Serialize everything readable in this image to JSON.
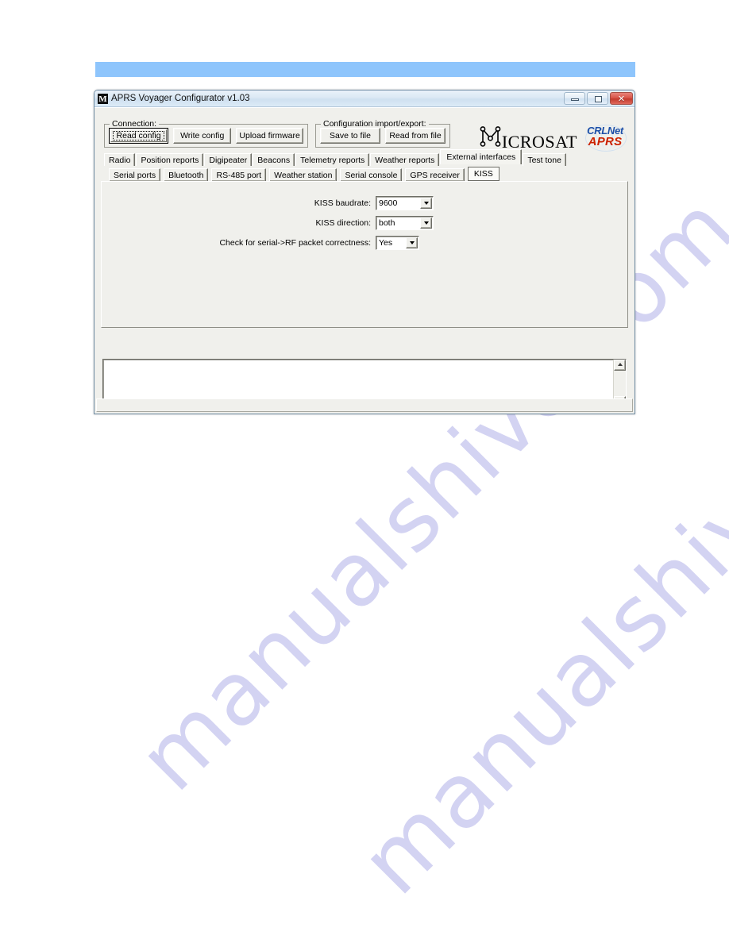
{
  "page": {
    "watermark": "manualshive.com",
    "band_color": "#8ec5fc"
  },
  "window": {
    "title": "APRS Voyager Configurator v1.03",
    "icon": "microsat-m-icon",
    "controls": {
      "minimize": "minimize-icon",
      "maximize": "maximize-icon",
      "close": "✕"
    }
  },
  "toolbar": {
    "connection_group": {
      "title": "Connection:",
      "buttons": [
        {
          "label": "Read config",
          "default": true
        },
        {
          "label": "Write config",
          "default": false
        },
        {
          "label": "Upload firmware",
          "default": false
        }
      ]
    },
    "config_group": {
      "title": "Configuration import/export:",
      "buttons": [
        {
          "label": "Save to file"
        },
        {
          "label": "Read from file"
        }
      ]
    }
  },
  "branding": {
    "microsat": "ICROSAT",
    "microsat_initial": "M",
    "crlnet": "CRLNet",
    "aprs": "APRS",
    "crlnet_color": "#1c4fa8",
    "aprs_color": "#cc2200"
  },
  "tabs": {
    "primary": [
      {
        "label": "Radio",
        "selected": false
      },
      {
        "label": "Position reports",
        "selected": false
      },
      {
        "label": "Digipeater",
        "selected": false
      },
      {
        "label": "Beacons",
        "selected": false
      },
      {
        "label": "Telemetry reports",
        "selected": false
      },
      {
        "label": "Weather reports",
        "selected": false
      },
      {
        "label": "External interfaces",
        "selected": true
      },
      {
        "label": "Test tone",
        "selected": false
      }
    ],
    "secondary": [
      {
        "label": "Serial ports",
        "selected": false
      },
      {
        "label": "Bluetooth",
        "selected": false
      },
      {
        "label": "RS-485 port",
        "selected": false
      },
      {
        "label": "Weather station",
        "selected": false
      },
      {
        "label": "Serial console",
        "selected": false
      },
      {
        "label": "GPS receiver",
        "selected": false
      },
      {
        "label": "KISS",
        "selected": true
      }
    ]
  },
  "form": {
    "rows": [
      {
        "label": "KISS baudrate:",
        "value": "9600"
      },
      {
        "label": "KISS direction:",
        "value": "both"
      },
      {
        "label": "Check for serial->RF packet correctness:",
        "value": "Yes"
      }
    ]
  },
  "log": {
    "content": ""
  },
  "status": {
    "text": ""
  }
}
